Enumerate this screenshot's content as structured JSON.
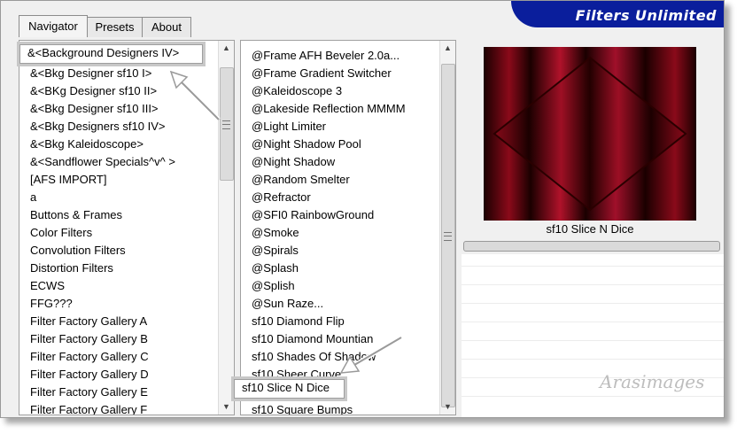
{
  "tabs": [
    {
      "label": "Navigator",
      "active": true
    },
    {
      "label": "Presets",
      "active": false
    },
    {
      "label": "About",
      "active": false
    }
  ],
  "brand": {
    "text": "Filters Unlimited"
  },
  "categories": {
    "highlighted": "&<Background Designers IV>",
    "items": [
      "&<Bkg Designer sf10 I>",
      "&<BKg Designer sf10 II>",
      "&<Bkg Designer sf10 III>",
      "&<Bkg Designers sf10 IV>",
      "&<Bkg Kaleidoscope>",
      "&<Sandflower Specials^v^ >",
      "[AFS IMPORT]",
      "a",
      "Buttons & Frames",
      "Color Filters",
      "Convolution Filters",
      "Distortion Filters",
      "ECWS",
      "FFG???",
      "Filter Factory Gallery A",
      "Filter Factory Gallery B",
      "Filter Factory Gallery C",
      "Filter Factory Gallery D",
      "Filter Factory Gallery E",
      "Filter Factory Gallery F"
    ]
  },
  "filters": {
    "items_before": [
      "@Frame AFH Beveler 2.0a...",
      "@Frame Gradient Switcher",
      "@Kaleidoscope 3",
      "@Lakeside Reflection MMMM",
      "@Light Limiter",
      "@Night Shadow Pool",
      "@Night Shadow",
      "@Random Smelter",
      "@Refractor",
      "@SFI0 RainbowGround",
      "@Smoke",
      "@Spirals",
      "@Splash",
      "@Splish",
      "@Sun Raze...",
      "sf10 Diamond Flip",
      "sf10 Diamond Mountian",
      "sf10 Shades Of Shadow",
      "sf10 Sheer Curve"
    ],
    "selected": "sf10 Slice N Dice",
    "items_after": [
      "sf10 Square Bumps"
    ]
  },
  "preview": {
    "caption": "sf10 Slice N Dice",
    "colors": {
      "dark": "#1a0000",
      "red": "#8a0a1a",
      "bright": "#b0122a"
    }
  },
  "watermark": "Arasimages"
}
